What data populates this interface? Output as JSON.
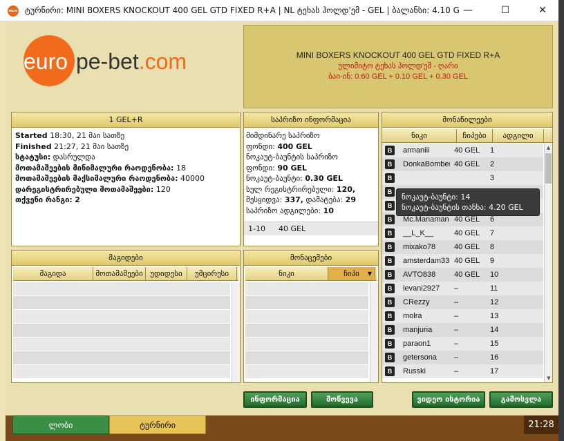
{
  "window": {
    "title": "ტურნირი: MINI BOXERS KNOCKOUT 400 GEL GTD FIXED R+A | NL ტეხას ჰოლდ'ემ - GEL | ბალანსი: 4.10 GEL (თა...",
    "app_icon": "euro",
    "minimize": "—",
    "maximize": "☐",
    "close": "✕"
  },
  "logo": {
    "euro": "euro",
    "rest": "pe-bet",
    "com": ".com"
  },
  "tournament_header": {
    "name": "MINI BOXERS KNOCKOUT 400 GEL GTD FIXED R+A",
    "game": "ულიმიტო ტეხას ჰოლდ'ემ - ღარი",
    "buyin": "ბაი-ინ: 0.60 GEL + 0.10 GEL + 0.30 GEL"
  },
  "main_panel": {
    "title": "1 GEL+R",
    "started_label": "Started",
    "started_value": "18:30, 21 მაი სათზე",
    "finished_label": "Finished",
    "finished_value": "21:27, 21 მაი სათზე",
    "status_label": "სტატუსი:",
    "status_value": "დასრულდა",
    "min_players_label": "მოთამაშეების მინიმალური რაოდენობა:",
    "min_players_value": "18",
    "max_players_label": "მოთამაშეების მაქსიმალური რაოდენობა:",
    "max_players_value": "40000",
    "registered_label": "დარეგისტრირებული მოთამაშეები:",
    "registered_value": "120",
    "rank_label": "თქვენი რანგი:",
    "rank_value": "2"
  },
  "prize_panel": {
    "title": "საპრიზო ინფორმაცია",
    "current_label": "მიმდინარე საპრიზო",
    "fund_label": "ფონდი:",
    "fund_value": "400 GEL",
    "knockout_fund_label1": "ნოკაუტ-ბაუნტის საპრიზო",
    "knockout_fund_label2": "ფონდი:",
    "knockout_fund_value": "90 GEL",
    "knockout_bounty_label": "ნოკაუტ-ბაუნტი:",
    "knockout_bounty_value": "0.30 GEL",
    "total_reg_label": "სულ რეგისტრირებული:",
    "total_reg_value": "120,",
    "rebuys_label": "შესყიდვა:",
    "rebuys_value": "337,",
    "addons_label": "დამატება:",
    "addons_value": "29",
    "paid_places_label": "საპრიზო ადგილები:",
    "paid_places_value": "10",
    "row_range": "1-10",
    "row_amount": "40 GEL"
  },
  "players_panel": {
    "title": "მონაწილეები",
    "col_name": "ნიკი",
    "col_chips": "ჩიპები",
    "col_place": "ადგილი",
    "rows": [
      {
        "name": "armaniii",
        "chips": "40 GEL",
        "place": "1"
      },
      {
        "name": "DonkaBomber",
        "chips": "40 GEL",
        "place": "2"
      },
      {
        "name": "",
        "chips": "",
        "place": "3"
      },
      {
        "name": "",
        "chips": "",
        "place": "4"
      },
      {
        "name": "BELLISSIMO",
        "chips": "40 GEL",
        "place": "5"
      },
      {
        "name": "Mc.Manaman",
        "chips": "40 GEL",
        "place": "6"
      },
      {
        "name": "__L_K__",
        "chips": "40 GEL",
        "place": "7"
      },
      {
        "name": "mixako78",
        "chips": "40 GEL",
        "place": "8"
      },
      {
        "name": "amsterdam333",
        "chips": "40 GEL",
        "place": "9"
      },
      {
        "name": "AVTO838",
        "chips": "40 GEL",
        "place": "10"
      },
      {
        "name": "levani2927",
        "chips": "–",
        "place": "11"
      },
      {
        "name": "CRezzy",
        "chips": "–",
        "place": "12"
      },
      {
        "name": "molra",
        "chips": "–",
        "place": "13"
      },
      {
        "name": "manjuria",
        "chips": "–",
        "place": "14"
      },
      {
        "name": "paraon1",
        "chips": "–",
        "place": "15"
      },
      {
        "name": "getersona",
        "chips": "–",
        "place": "16"
      },
      {
        "name": "Russki",
        "chips": "–",
        "place": "17"
      }
    ],
    "badge": "B"
  },
  "tooltip": {
    "line1": "ნოკაუტ-ბაუნტი: 14",
    "line2": "ნოკაუტ-ბაუნტის თანხა: 4.20 GEL"
  },
  "tables_panel": {
    "title": "მაგიდები",
    "col_table": "მაგიდა",
    "col_players": "მოთამაშეები",
    "col_largest": "უდიდესი",
    "col_smallest": "უმცირესი"
  },
  "competitors_panel": {
    "title": "მონაცემები",
    "col_name": "ნიკი",
    "col_chips": "ჩიპი"
  },
  "buttons": {
    "info": "ინფორმაცია",
    "join": "მოწვევა",
    "video_history": "ვიდეო ისტორია",
    "exit": "გამოსვლა"
  },
  "bottom": {
    "tab_lobby": "ლობი",
    "tab_tournament": "ტურნირი",
    "clock": "21:28"
  }
}
